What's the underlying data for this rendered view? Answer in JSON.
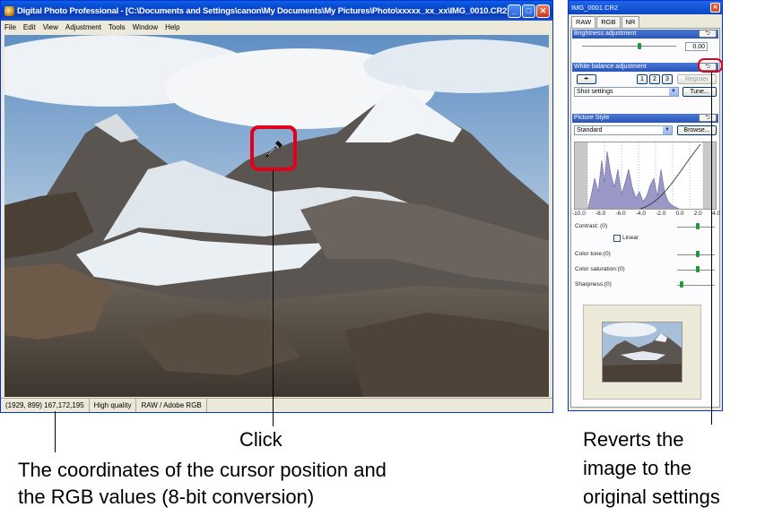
{
  "main_window": {
    "title": "Digital Photo Professional - [C:\\Documents and Settings\\canon\\My Documents\\My Pictures\\Photo\\xxxxx_xx_xx\\IMG_0010.CR2 ●]",
    "menu": [
      "File",
      "Edit",
      "View",
      "Adjustment",
      "Tools",
      "Window",
      "Help"
    ],
    "status": {
      "coordinates": "(1929, 899)",
      "rgb": "167,172,195",
      "quality": "High quality",
      "color_space": "RAW / Adobe RGB"
    }
  },
  "palette": {
    "title": "IMG_0001.CR2",
    "tabs": [
      "RAW",
      "RGB",
      "NR"
    ],
    "brightness": {
      "header": "Brightness adjustment",
      "value": "0.00",
      "level": 0.0
    },
    "white_balance": {
      "header": "White balance adjustment",
      "presets": [
        "1",
        "2",
        "3"
      ],
      "register_label": "Register",
      "selected": "Shot settings",
      "tune_label": "Tune..."
    },
    "picture_style": {
      "header": "Picture Style",
      "selected": "Standard",
      "browse_label": "Browse...",
      "scale": [
        "-10.0",
        "-8.0",
        "-6.0",
        "-4.0",
        "-2.0",
        "0.0",
        "2.0",
        "4.0"
      ],
      "contrast_label": "Contrast: (0)",
      "linear_label": "Linear",
      "color_tone_label": "Color tone:(0)",
      "color_saturation_label": "Color saturation:(0)",
      "sharpness_label": "Sharpness:(0)"
    }
  },
  "annotations": {
    "click": "Click",
    "status_caption_line1": "The coordinates of the cursor position and",
    "status_caption_line2": "the RGB values (8-bit conversion)",
    "revert_line1": "Reverts the",
    "revert_line2": "image to the",
    "revert_line3": "original settings"
  },
  "colors": {
    "highlight": "#e4001a",
    "xp_title": "#0842c4"
  }
}
